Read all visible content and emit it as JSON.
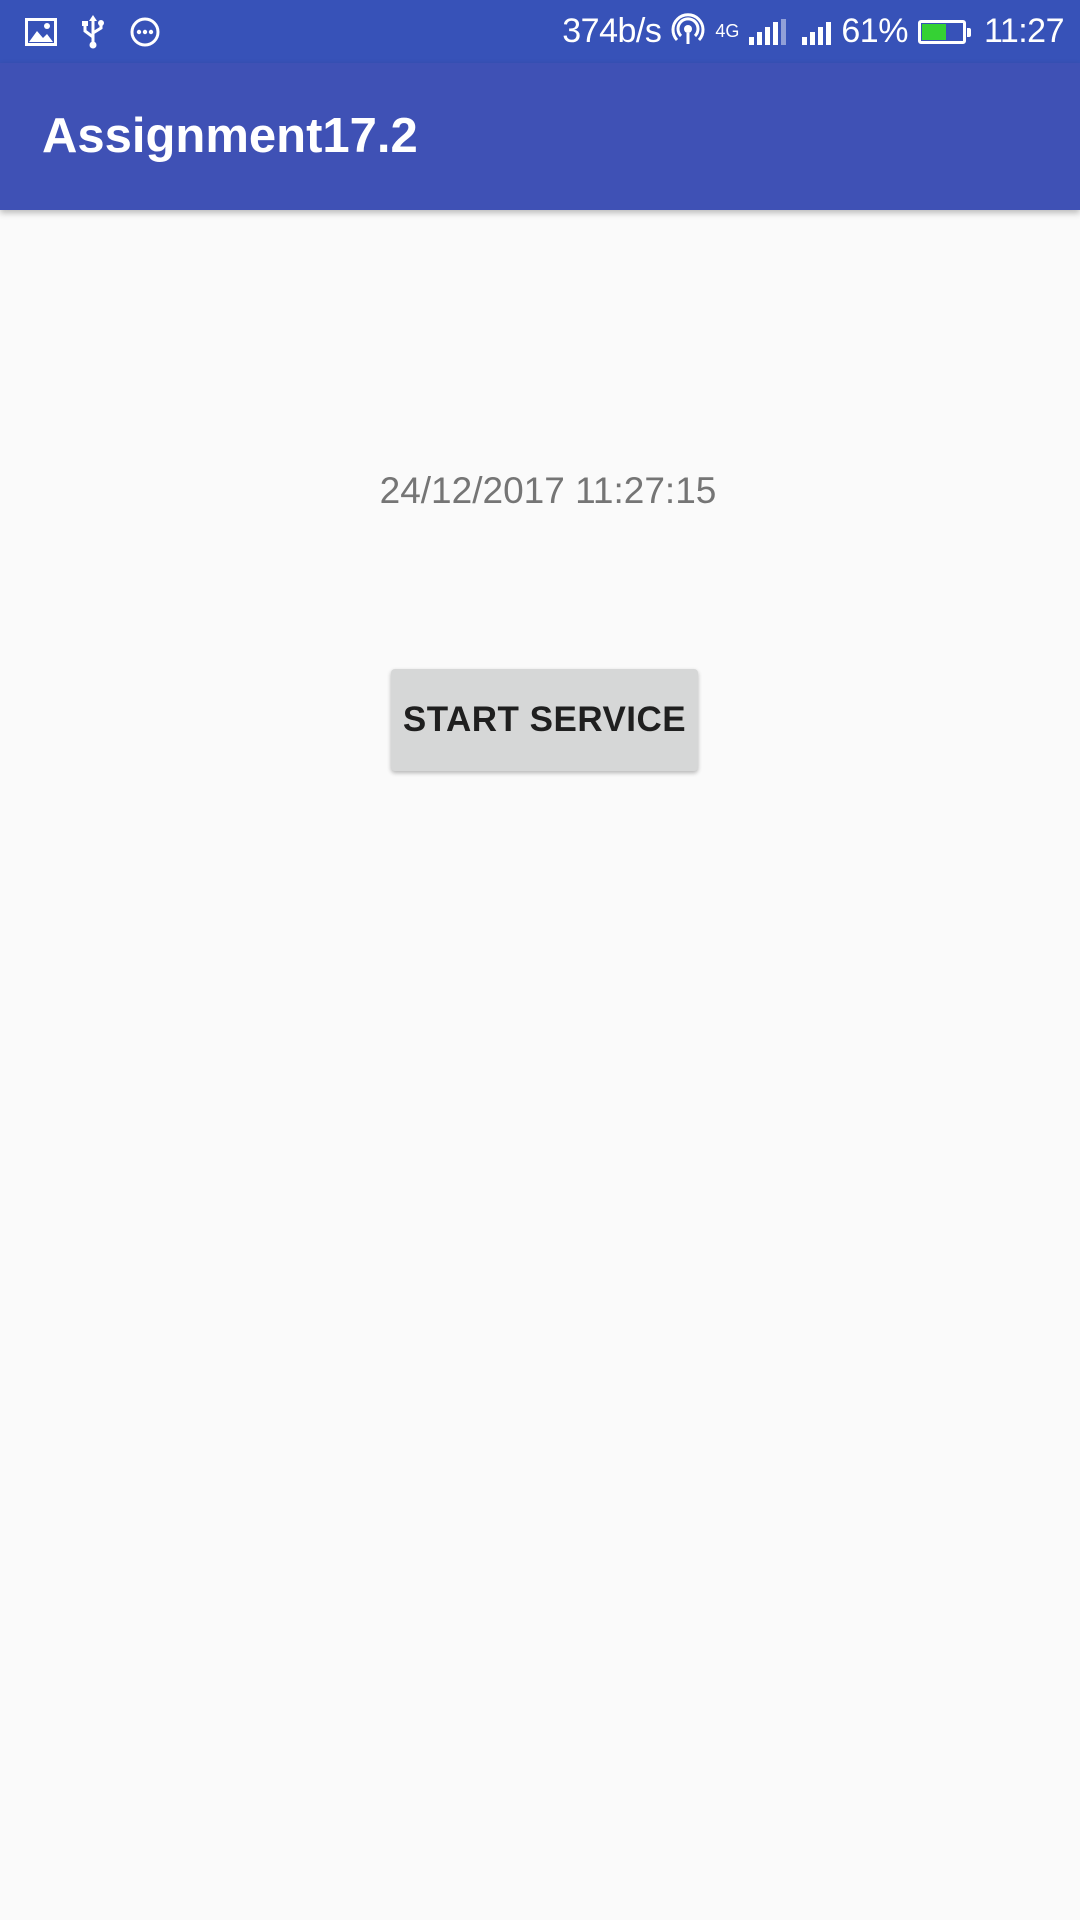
{
  "status_bar": {
    "left_icons": [
      "image-icon",
      "usb-icon",
      "more-circle-icon"
    ],
    "net_speed": "374b/s",
    "network_type": "4G",
    "battery_percent_text": "61%",
    "battery_level": 0.61,
    "battery_color": "#35d134",
    "time": "11:27",
    "background": "#3752b8"
  },
  "app_bar": {
    "title": "Assignment17.2",
    "background": "#3f51b5"
  },
  "main": {
    "datetime": "24/12/2017 11:27:15",
    "start_button_label": "START SERVICE"
  }
}
